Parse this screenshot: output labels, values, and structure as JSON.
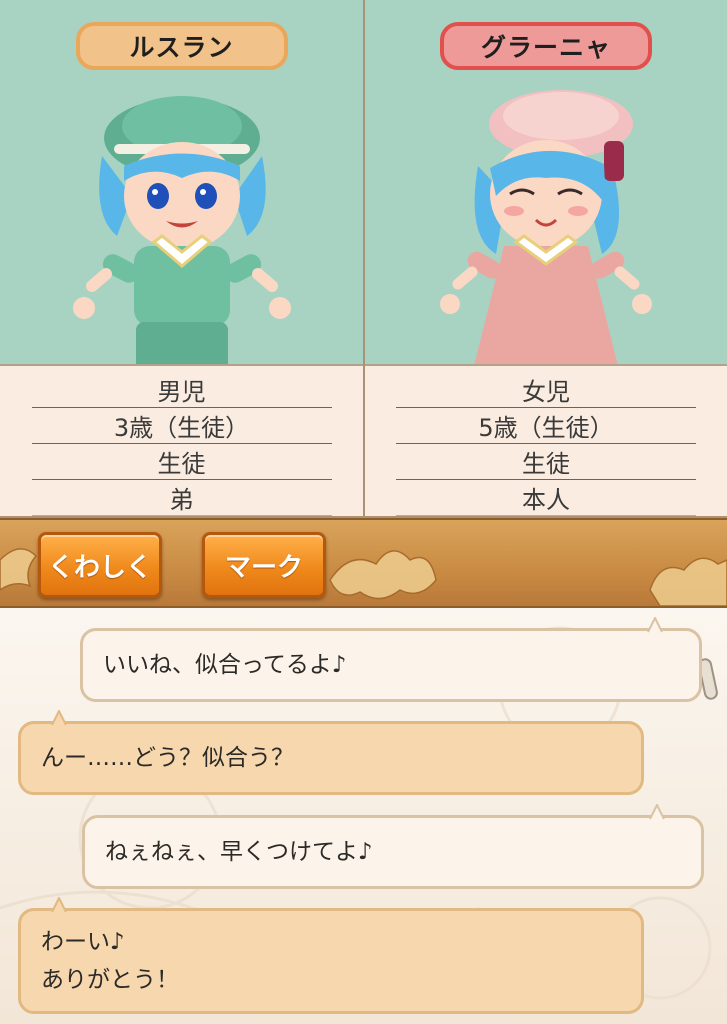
{
  "characters": [
    {
      "name": "ルスラン",
      "gender": "男児",
      "age": "3歳（生徒）",
      "role": "生徒",
      "relation": "弟",
      "tag_color": "#f2c28b",
      "outfit_color": "#6ec0a0"
    },
    {
      "name": "グラーニャ",
      "gender": "女児",
      "age": "5歳（生徒）",
      "role": "生徒",
      "relation": "本人",
      "tag_color": "#ee9a98",
      "outfit_color": "#eaa6a0"
    }
  ],
  "toolbar": {
    "details_label": "くわしく",
    "mark_label": "マーク"
  },
  "chat": {
    "messages": [
      {
        "side": "right",
        "lines": [
          "いいね、似合ってるよ♪"
        ]
      },
      {
        "side": "left",
        "lines": [
          "んー……どう？似合う？"
        ]
      },
      {
        "side": "right",
        "lines": [
          "ねぇねぇ、早くつけてよ♪"
        ]
      },
      {
        "side": "left",
        "lines": [
          "わーい♪",
          "ありがとう！"
        ]
      }
    ]
  },
  "colors": {
    "portrait_bg": "#a8d3c3",
    "toolbar": "#c98b43",
    "button": "#f08a1c"
  }
}
